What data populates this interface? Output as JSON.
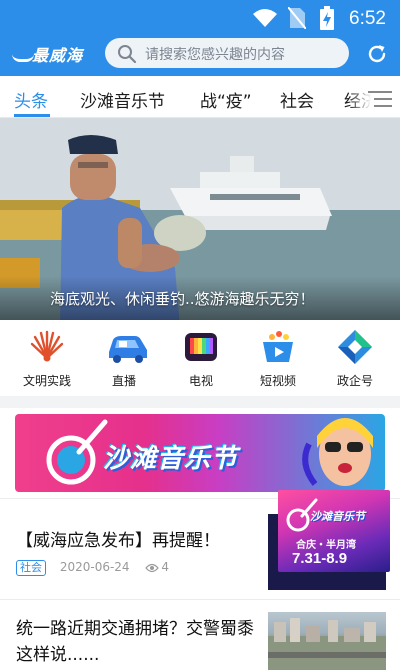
{
  "status": {
    "time": "6:52"
  },
  "header": {
    "logo": "最威海",
    "search_placeholder": "请搜索您感兴趣的内容"
  },
  "tabs": [
    "头条",
    "沙滩音乐节",
    "战“疫”",
    "社会",
    "经济"
  ],
  "banner": {
    "caption": "海底观光、休闲垂钓..悠游海趣乐无穷！"
  },
  "quick_links": [
    {
      "label": "文明实践",
      "icon": "fan-icon"
    },
    {
      "label": "直播",
      "icon": "car-icon"
    },
    {
      "label": "电视",
      "icon": "tv-icon"
    },
    {
      "label": "短视频",
      "icon": "video-cup-icon"
    },
    {
      "label": "政企号",
      "icon": "diamond-icon"
    }
  ],
  "ad": {
    "title": "沙滩音乐节"
  },
  "news": [
    {
      "title": "【威海应急发布】再提醒！",
      "tag": "社会",
      "date": "2020-06-24",
      "views": "4",
      "poster": {
        "title": "沙滩音乐节",
        "location": "合庆・半月湾",
        "dates": "7.31-8.9"
      }
    },
    {
      "title": "统一路近期交通拥堵？交警蜀黍这样说......"
    }
  ],
  "colors": {
    "primary": "#2c8ee8",
    "tab_active": "#2c8ee8"
  }
}
